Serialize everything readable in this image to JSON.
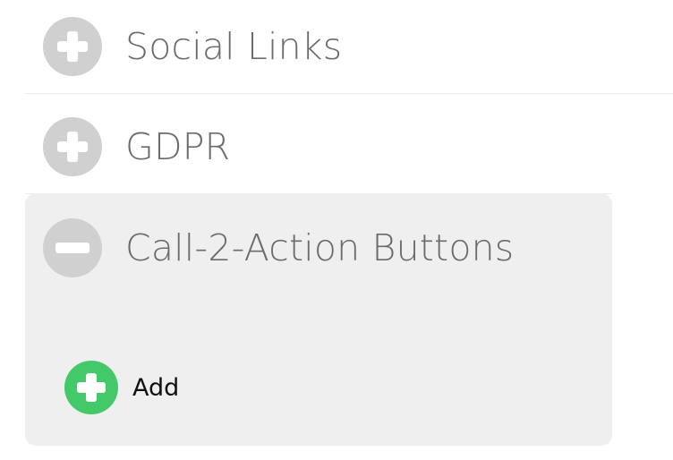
{
  "sections": [
    {
      "title": "Social Links",
      "state": "collapsed",
      "toggle_icon": "plus-icon"
    },
    {
      "title": "GDPR",
      "state": "collapsed",
      "toggle_icon": "plus-icon"
    },
    {
      "title": "Call-2-Action Buttons",
      "state": "expanded",
      "toggle_icon": "minus-icon"
    }
  ],
  "cta": {
    "add_label": "Add",
    "add_icon": "plus-icon"
  },
  "colors": {
    "toggle_bg": "#d0d0d0",
    "expanded_panel_bg": "#efefef",
    "add_accent": "#44c96a",
    "title_text": "#6b6b6b"
  }
}
